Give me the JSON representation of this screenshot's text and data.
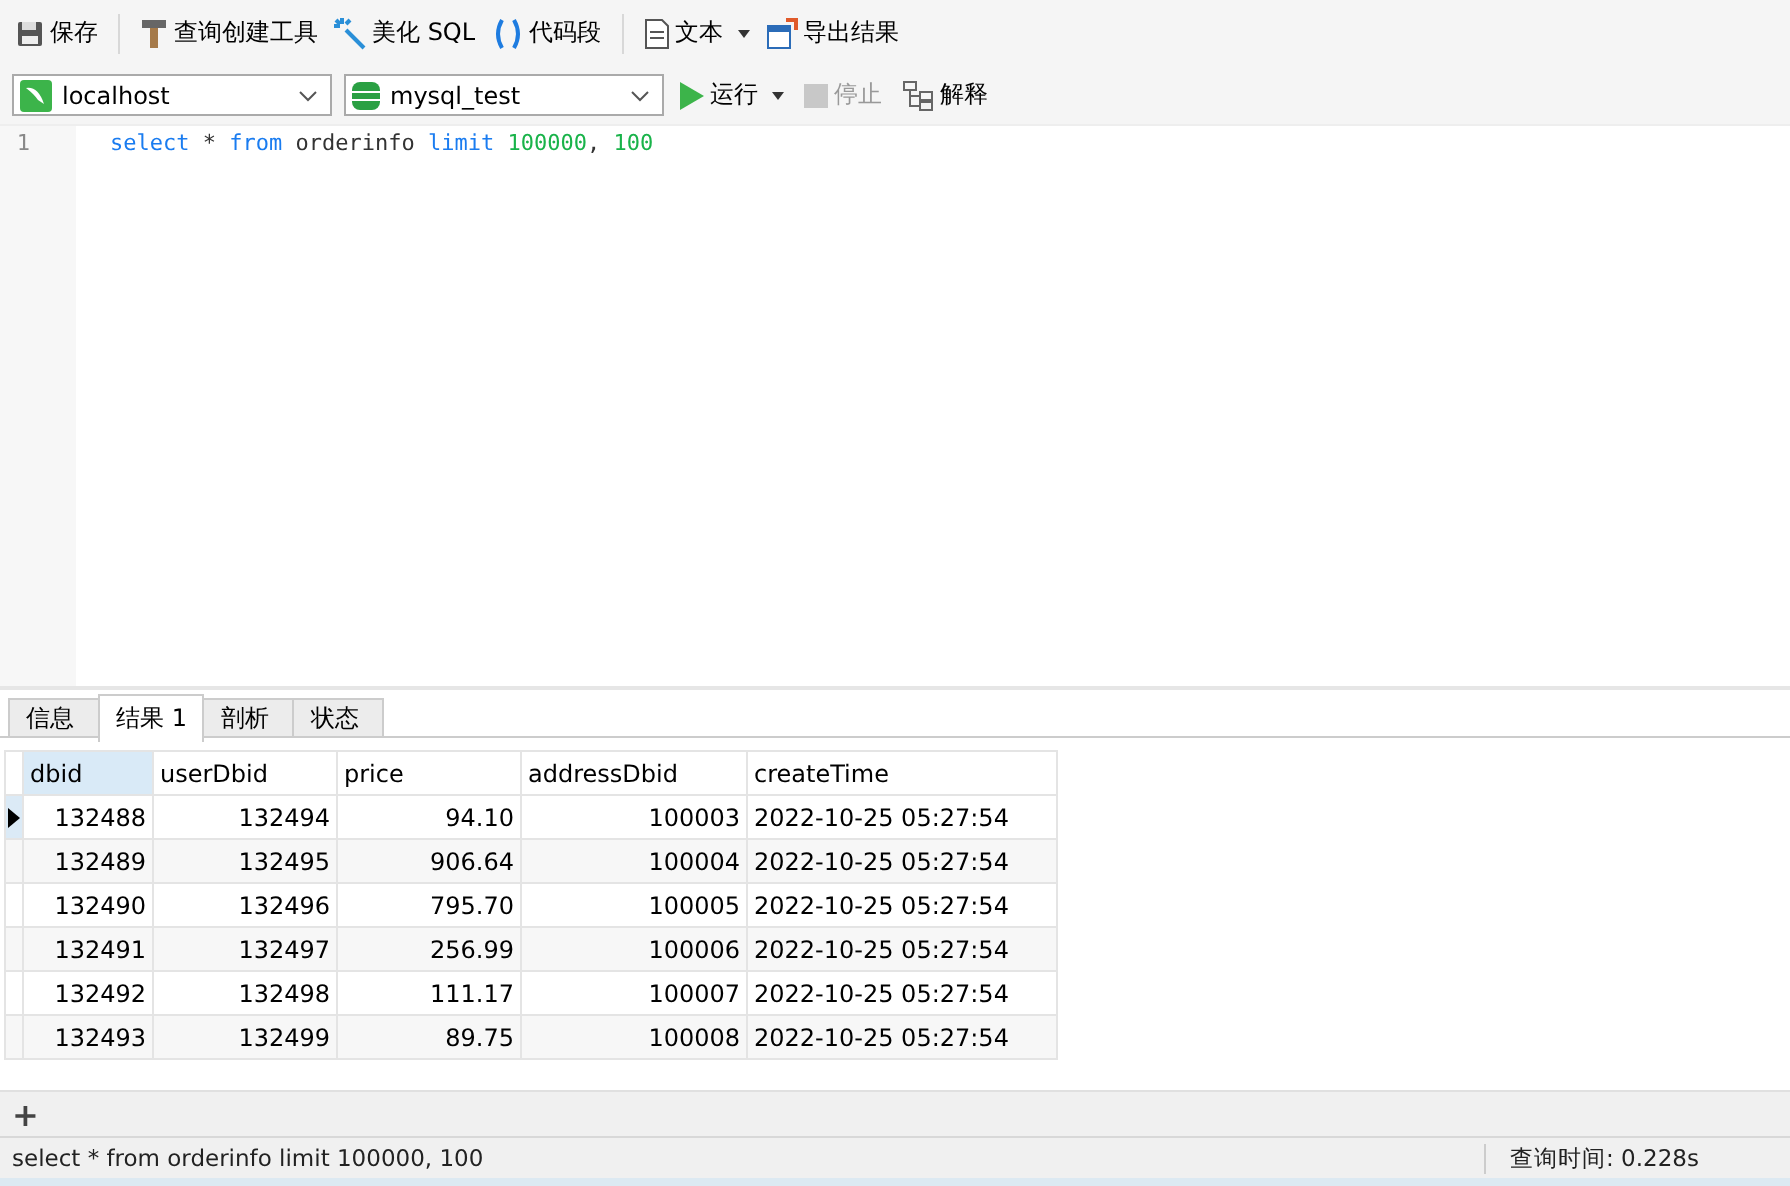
{
  "toolbar": [
    {
      "kind": "save",
      "label": "保存"
    },
    {
      "kind": "builder",
      "label": "查询创建工具"
    },
    {
      "kind": "beautify",
      "label": "美化 SQL"
    },
    {
      "kind": "snippet",
      "label": "代码段"
    },
    {
      "kind": "text",
      "label": "文本"
    },
    {
      "kind": "export",
      "label": "导出结果"
    }
  ],
  "connection": {
    "value": "localhost"
  },
  "database": {
    "value": "mysql_test"
  },
  "actions": [
    {
      "kind": "run",
      "label": "运行",
      "disabled": false
    },
    {
      "kind": "stop",
      "label": "停止",
      "disabled": true
    },
    {
      "kind": "explain",
      "label": "解释",
      "disabled": false
    }
  ],
  "editor": {
    "lines": [
      {
        "number": "1",
        "tokens": [
          {
            "kind": "keyword",
            "text": "select"
          },
          {
            "kind": "plain",
            "text": " * "
          },
          {
            "kind": "keyword",
            "text": "from"
          },
          {
            "kind": "plain",
            "text": " orderinfo "
          },
          {
            "kind": "keyword",
            "text": "limit"
          },
          {
            "kind": "number",
            "text": " 100000"
          },
          {
            "kind": "plain",
            "text": ", "
          },
          {
            "kind": "number",
            "text": "100"
          }
        ]
      }
    ]
  },
  "tabs": [
    {
      "label": "信息",
      "selected": false
    },
    {
      "label": "结果 1",
      "selected": true
    },
    {
      "label": "剖析",
      "selected": false
    },
    {
      "label": "状态",
      "selected": false
    }
  ],
  "table": {
    "columns": [
      {
        "label": "dbid",
        "selected": true
      },
      {
        "label": "userDbid",
        "selected": false
      },
      {
        "label": "price",
        "selected": false
      },
      {
        "label": "addressDbid",
        "selected": false
      },
      {
        "label": "createTime",
        "selected": false
      }
    ],
    "rows": [
      {
        "selected": true,
        "cells": [
          "132488",
          "132494",
          "94.10",
          "100003",
          "2022-10-25 05:27:54"
        ]
      },
      {
        "selected": false,
        "cells": [
          "132489",
          "132495",
          "906.64",
          "100004",
          "2022-10-25 05:27:54"
        ]
      },
      {
        "selected": false,
        "cells": [
          "132490",
          "132496",
          "795.70",
          "100005",
          "2022-10-25 05:27:54"
        ]
      },
      {
        "selected": false,
        "cells": [
          "132491",
          "132497",
          "256.99",
          "100006",
          "2022-10-25 05:27:54"
        ]
      },
      {
        "selected": false,
        "cells": [
          "132492",
          "132498",
          "111.17",
          "100007",
          "2022-10-25 05:27:54"
        ]
      },
      {
        "selected": false,
        "cells": [
          "132493",
          "132499",
          "89.75",
          "100008",
          "2022-10-25 05:27:54"
        ]
      }
    ]
  },
  "grid_toolbar": {
    "add": "+"
  },
  "status_bar": {
    "query": "select * from orderinfo limit 100000, 100",
    "time": "查询时间: 0.228s"
  }
}
